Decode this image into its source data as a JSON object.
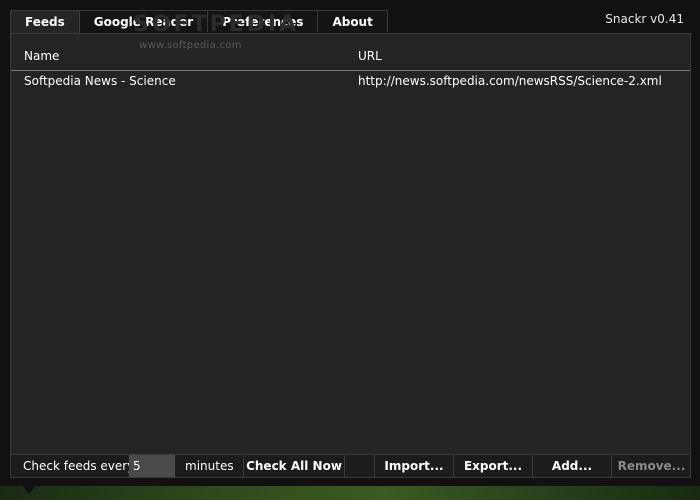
{
  "app": {
    "title": "Snackr v0.41"
  },
  "tabs": [
    {
      "label": "Feeds",
      "active": true
    },
    {
      "label": "Google Reader",
      "active": false
    },
    {
      "label": "Preferences",
      "active": false
    },
    {
      "label": "About",
      "active": false
    }
  ],
  "watermark": {
    "brand": "SOFTPEDIA",
    "url": "www.softpedia.com"
  },
  "table": {
    "columns": {
      "name": "Name",
      "url": "URL"
    },
    "rows": [
      {
        "name": "Softpedia News - Science",
        "url": "http://news.softpedia.com/newsRSS/Science-2.xml"
      }
    ]
  },
  "toolbar": {
    "check_label": "Check feeds every",
    "interval_value": "5",
    "minutes_label": "minutes",
    "check_all": "Check All Now",
    "import": "Import...",
    "export": "Export...",
    "add": "Add...",
    "remove": "Remove..."
  },
  "colors": {
    "background": "#111111",
    "panel": "#242424",
    "text": "#ffffff",
    "disabled": "#8a8a8a"
  }
}
